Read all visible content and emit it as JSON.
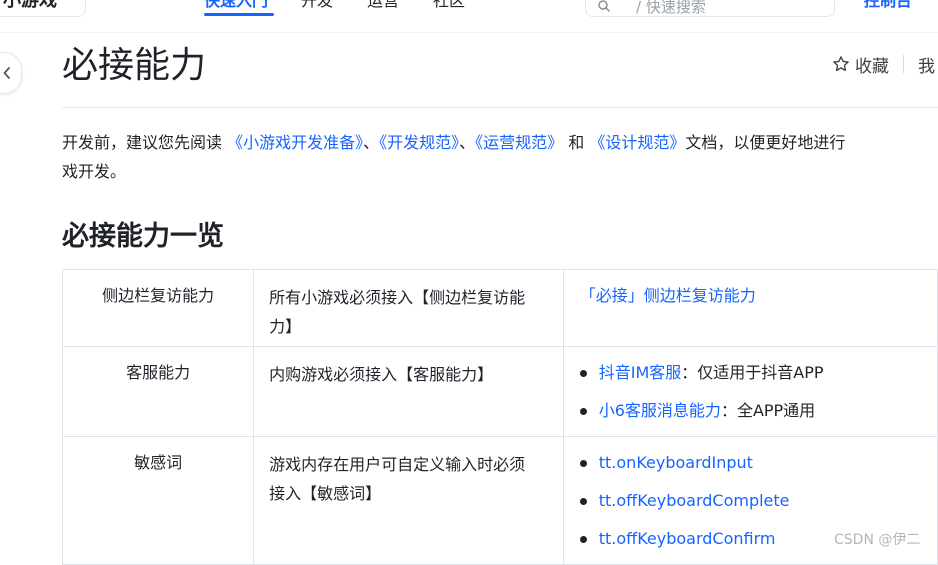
{
  "nav": {
    "brand": "小游戏",
    "items": [
      {
        "label": "快速入门",
        "active": true
      },
      {
        "label": "开发",
        "active": false
      },
      {
        "label": "运营",
        "active": false
      },
      {
        "label": "社区",
        "active": false
      }
    ],
    "search_placeholder": "/ 快速搜索",
    "console": "控制台"
  },
  "page": {
    "title": "必接能力",
    "favorite_label": "收藏",
    "more_label": "我"
  },
  "intro": {
    "prefix": "开发前，建议您先阅读",
    "link1": "《小游戏开发准备》",
    "sep1": "、",
    "link2": "《开发规范》",
    "sep2": "、",
    "link3": "《运营规范》",
    "and": "和",
    "link4": "《设计规范》",
    "suffix": "文档，以便更好地进行",
    "line2": "戏开发。"
  },
  "section": {
    "title": "必接能力一览"
  },
  "table": {
    "rows": [
      {
        "name": "侧边栏复访能力",
        "desc_line1": "所有小游戏必须接入【侧边栏复访能",
        "desc_line2": "力】",
        "link": "「必接」侧边栏复访能力"
      },
      {
        "name": "客服能力",
        "desc": "内购游戏必须接入【客服能力】",
        "items": [
          {
            "link": "抖音IM客服",
            "text": "：仅适用于抖音APP"
          },
          {
            "link": "小6客服消息能力",
            "text": "：全APP通用"
          }
        ]
      },
      {
        "name": "敏感词",
        "desc_line1": "游戏内存在用户可自定义输入时必须",
        "desc_line2": "接入【敏感词】",
        "items": [
          {
            "link": "tt.onKeyboardInput"
          },
          {
            "link": "tt.offKeyboardComplete"
          },
          {
            "link": "tt.offKeyboardConfirm"
          }
        ]
      }
    ]
  },
  "watermark": "CSDN @伊二",
  "colors": {
    "link": "#1664ff",
    "text": "#1f2329",
    "border": "#dfe2e6"
  }
}
